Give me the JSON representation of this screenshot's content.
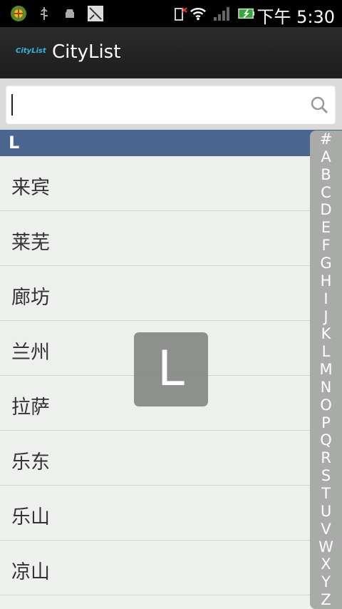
{
  "status_bar": {
    "time": "下午 5:30",
    "icons": [
      "app-icon",
      "usb-icon",
      "android-debug-icon",
      "screenshot-icon",
      "no-sim-icon",
      "wifi-icon",
      "signal-icon",
      "battery-icon"
    ]
  },
  "title_bar": {
    "logo_text": "CityList",
    "title": "CityList"
  },
  "search": {
    "value": "",
    "icon": "search-icon"
  },
  "section": {
    "header": "L"
  },
  "cities": [
    "来宾",
    "莱芜",
    "廊坊",
    "兰州",
    "拉萨",
    "乐东",
    "乐山",
    "凉山"
  ],
  "index_letters": [
    "#",
    "A",
    "B",
    "C",
    "D",
    "E",
    "F",
    "G",
    "H",
    "I",
    "J",
    "K",
    "L",
    "M",
    "N",
    "O",
    "P",
    "Q",
    "R",
    "S",
    "T",
    "U",
    "V",
    "W",
    "X",
    "Y",
    "Z"
  ],
  "overlay": {
    "letter": "L"
  }
}
